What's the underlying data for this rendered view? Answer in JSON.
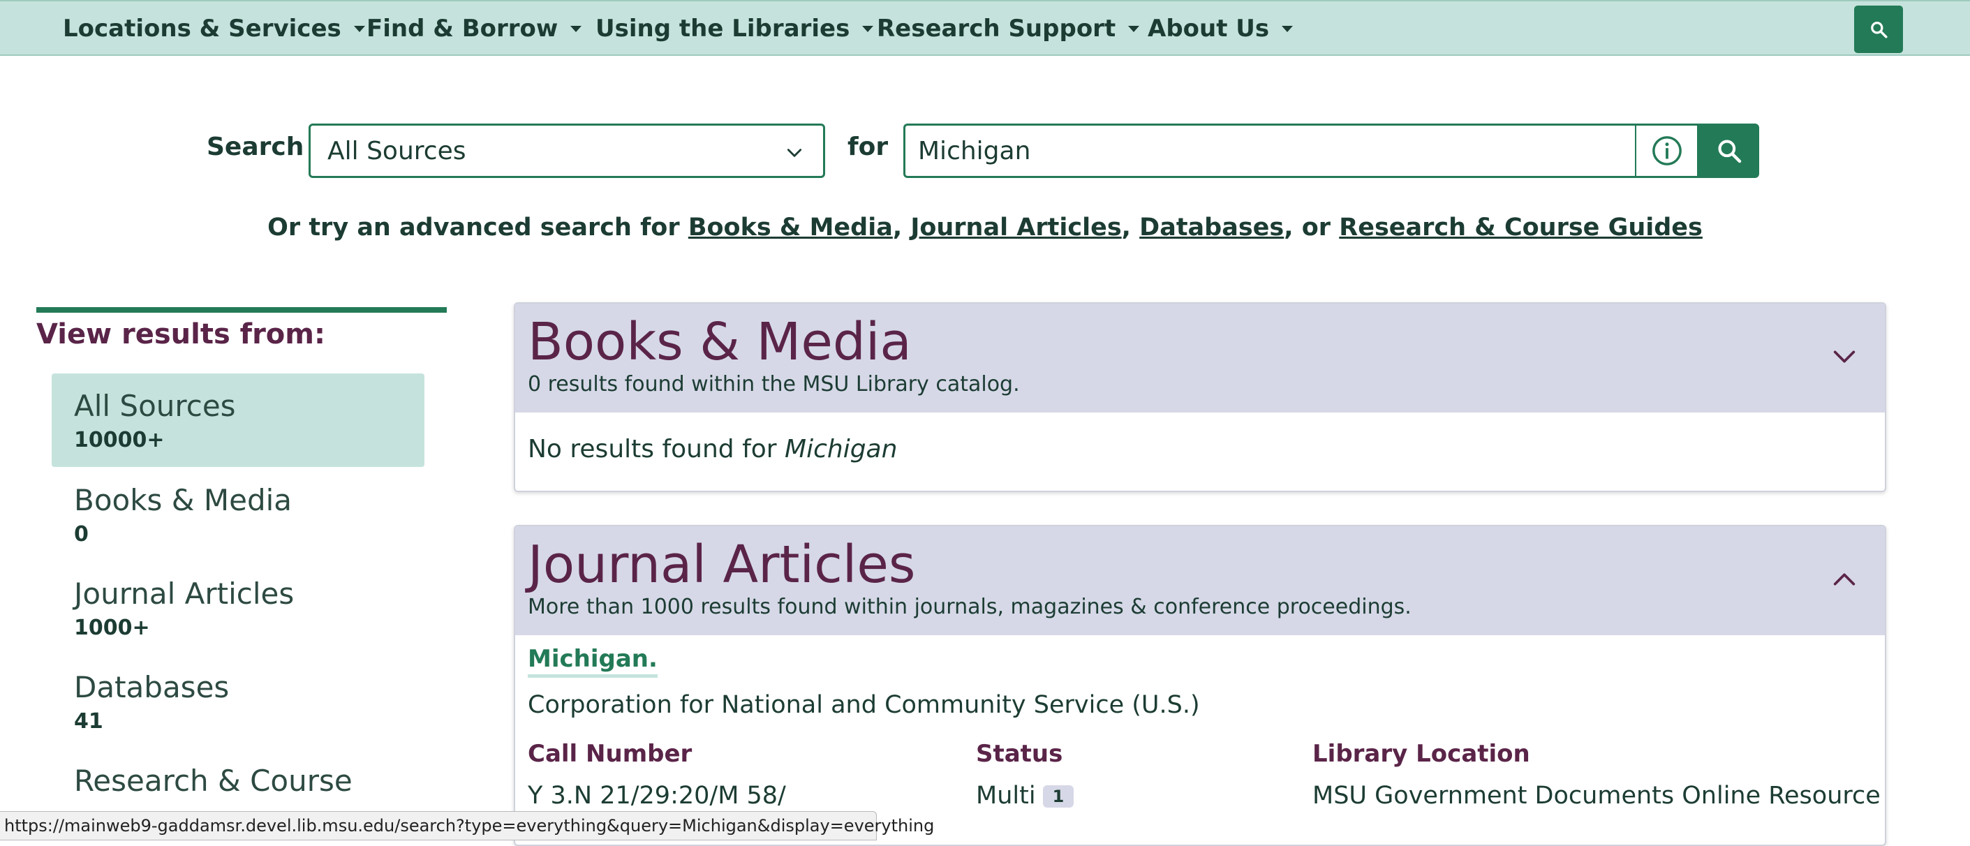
{
  "nav": {
    "items": [
      {
        "label": "Locations & Services"
      },
      {
        "label": "Find & Borrow"
      },
      {
        "label": "Using the Libraries"
      },
      {
        "label": "Research Support"
      },
      {
        "label": "About Us"
      }
    ],
    "search_icon": "search-icon"
  },
  "search": {
    "label": "Search",
    "source_selected": "All Sources",
    "for_label": "for",
    "query": "Michigan"
  },
  "advanced": {
    "prefix": "Or try an advanced search for ",
    "books": "Books & Media",
    "comma1": ", ",
    "articles": "Journal Articles",
    "comma2": ", ",
    "databases": "Databases",
    "or": ", or ",
    "guides": "Research & Course Guides"
  },
  "sidebar": {
    "heading": "View results from:",
    "facets": [
      {
        "label": "All Sources",
        "count": "10000+"
      },
      {
        "label": "Books & Media",
        "count": "0"
      },
      {
        "label": "Journal Articles",
        "count": "1000+"
      },
      {
        "label": "Databases",
        "count": "41"
      },
      {
        "label": "Research & Course",
        "count": ""
      }
    ]
  },
  "books_panel": {
    "title": "Books & Media",
    "subtitle": "0 results found within the MSU Library catalog.",
    "no_results_prefix": "No results found for ",
    "no_results_query": "Michigan"
  },
  "articles_panel": {
    "title": "Journal Articles",
    "subtitle": "More than 1000 results found within journals, magazines & conference proceedings.",
    "result": {
      "title": "Michigan.",
      "author": "Corporation for National and Community Service (U.S.)",
      "call_number_label": "Call Number",
      "call_number": "Y 3.N 21/29:20/M 58/",
      "status_label": "Status",
      "status": "Multi",
      "status_badge": "1",
      "location_label": "Library Location",
      "location": "MSU Government Documents Online Resource"
    }
  },
  "statusbar": {
    "url": "https://mainweb9-gaddamsr.devel.lib.msu.edu/search?type=everything&query=Michigan&display=everything"
  },
  "colors": {
    "nav_bg": "#c5e3dc",
    "accent_green": "#237a57",
    "heading_purple": "#5a2448",
    "panel_head_bg": "#d6d8e7"
  }
}
